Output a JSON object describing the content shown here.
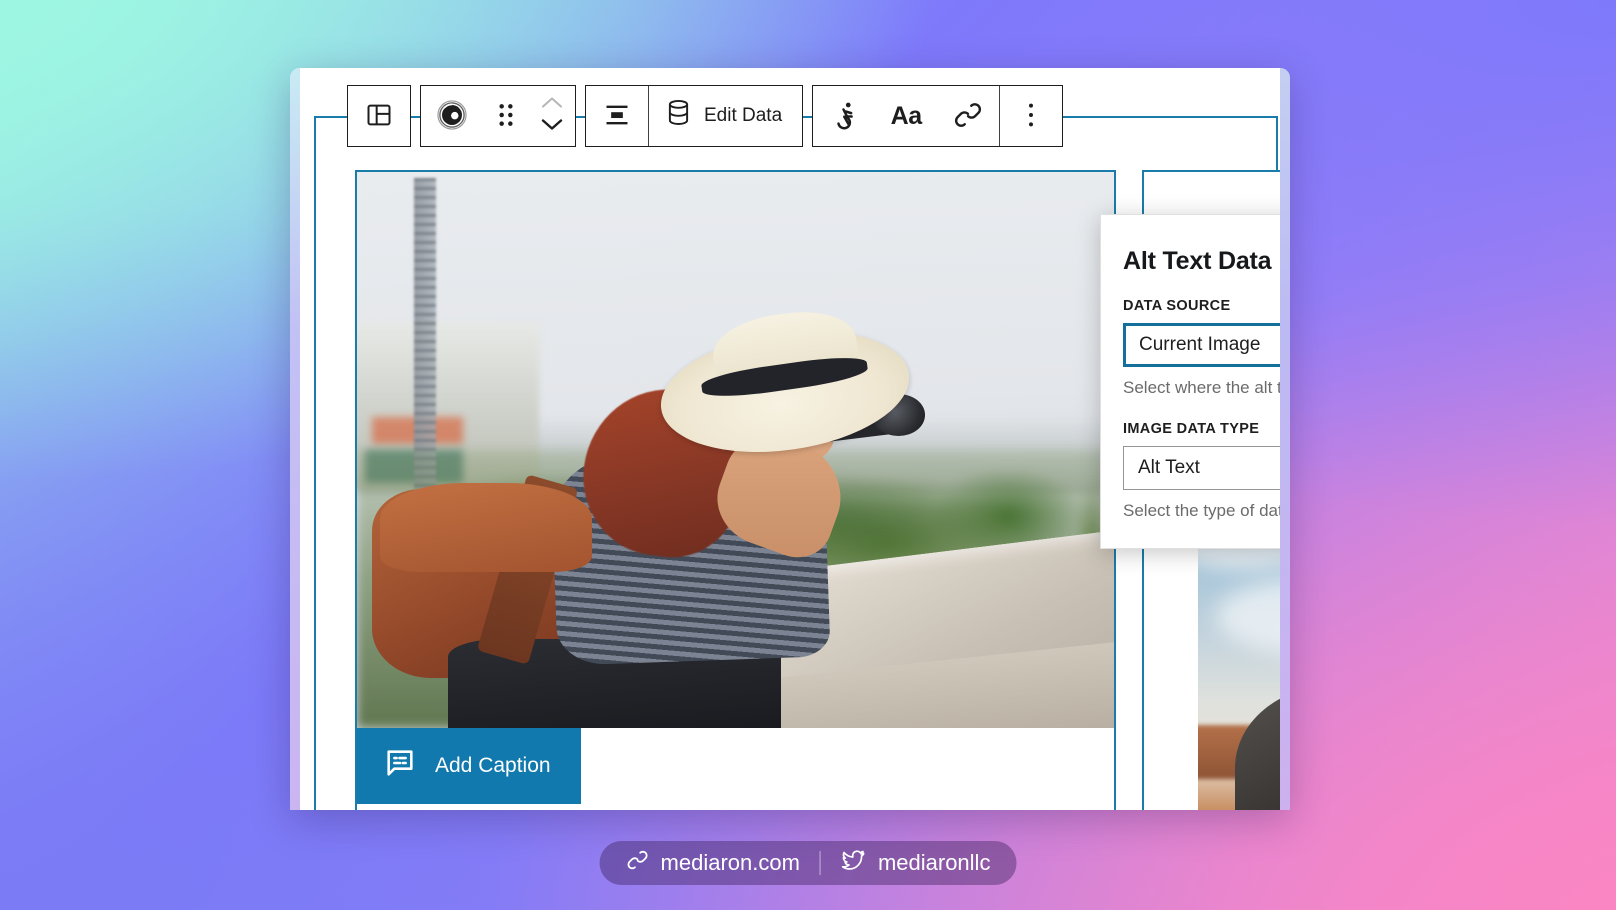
{
  "background": {
    "gradient_stops": [
      "#9df6e2",
      "#7e79fb",
      "#9a7ef5",
      "#f189d3"
    ]
  },
  "accent": {
    "selection_blue": "#1a7ca8",
    "focus_blue": "#14709a",
    "button_blue": "#1179ad"
  },
  "ghost_strip": {
    "left_text": "",
    "right_text": ""
  },
  "toolbar": {
    "items": [
      {
        "name": "select-parent-block",
        "icon": "layout-sidebar-icon",
        "label": ""
      },
      {
        "name": "block-type-image",
        "icon": "camera-lens-icon",
        "label": ""
      },
      {
        "name": "drag-handle",
        "icon": "drag-dots-icon",
        "label": ""
      },
      {
        "name": "move-block",
        "icon": "chevron-up-down-icon",
        "label": ""
      },
      {
        "name": "align-block",
        "icon": "align-center-icon",
        "label": ""
      },
      {
        "name": "edit-data",
        "icon": "database-icon",
        "label": "Edit Data"
      },
      {
        "name": "accessibility",
        "icon": "accessibility-icon",
        "label": ""
      },
      {
        "name": "typography",
        "icon": "typography-aa-icon",
        "label": "Aa"
      },
      {
        "name": "link",
        "icon": "link-chain-icon",
        "label": ""
      },
      {
        "name": "more-options",
        "icon": "vertical-dots-icon",
        "label": ""
      }
    ],
    "edit_data_label": "Edit Data",
    "typography_label": "Aa"
  },
  "popover": {
    "title": "Alt Text Data",
    "fields": [
      {
        "label": "DATA SOURCE",
        "value": "Current Image",
        "help": "Select where the alt text should come from.",
        "focused": true
      },
      {
        "label": "IMAGE DATA TYPE",
        "value": "Alt Text",
        "help": "Select the type of data to use for the alt text.",
        "focused": false
      }
    ]
  },
  "image_block": {
    "caption_button_label": "Add Caption",
    "caption_button_icon": "caption-bubble-icon",
    "alt": "Woman in a straw hat with a backpack taking a photograph from a stone terrace"
  },
  "image_block_2": {
    "alt": "Desert canyon landscape with blue sky and clouds"
  },
  "footer": {
    "site": {
      "icon": "link-chain-icon",
      "label": "mediaron.com"
    },
    "social": {
      "icon": "twitter-bird-icon",
      "label": "mediaronllc"
    }
  }
}
